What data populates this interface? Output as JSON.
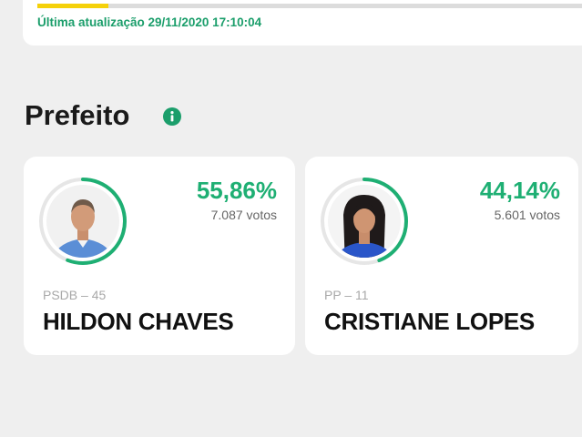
{
  "status": {
    "progress_fraction": 0.13,
    "progress_color": "#f5d10a",
    "last_update": "Última atualização 29/11/2020 17:10:04"
  },
  "section": {
    "title": "Prefeito",
    "info_icon": "info-icon"
  },
  "colors": {
    "accent_green": "#1eaf73",
    "ring_track": "#e6e6e6"
  },
  "candidates": [
    {
      "percent": "55,86%",
      "vote_share": 55.86,
      "votes": "7.087 votos",
      "party": "PSDB – 45",
      "name": "HILDON CHAVES",
      "photo_icon": "candidate-photo"
    },
    {
      "percent": "44,14%",
      "vote_share": 44.14,
      "votes": "5.601 votos",
      "party": "PP – 11",
      "name": "CRISTIANE LOPES",
      "photo_icon": "candidate-photo"
    }
  ]
}
